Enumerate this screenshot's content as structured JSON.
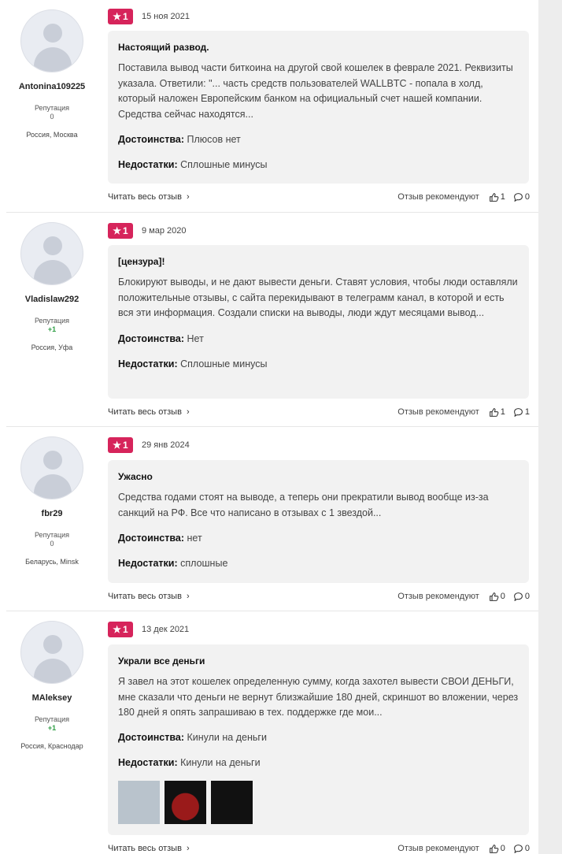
{
  "reviews": [
    {
      "username": "Antonina109225",
      "reputation_label": "Репутация",
      "reputation_value": "0",
      "location": "Россия, Москва",
      "rating": "1",
      "date": "15 ноя 2021",
      "title": "Настоящий развод.",
      "text": "Поставила вывод части биткоина на другой свой кошелек в феврале 2021. Реквизиты указала. Ответили: \"... часть средств пользователей WALLBTC - попала в холд, который наложен Европейским банком на официальный счет нашей компании. Средства сейчас находятся...",
      "pros_label": "Достоинства:",
      "pros": "Плюсов нет",
      "cons_label": "Недостатки:",
      "cons": "Сплошные минусы",
      "read_more": "Читать весь отзыв",
      "recommend": "Отзыв рекомендуют",
      "likes": "1",
      "comments": "0"
    },
    {
      "username": "Vladislaw292",
      "reputation_label": "Репутация",
      "reputation_value": "+1",
      "location": "Россия, Уфа",
      "rating": "1",
      "date": "9 мар 2020",
      "title": "[цензура]!",
      "text": "Блокируют выводы, и не дают вывести деньги. Ставят условия, чтобы люди оставляли положительные отзывы, с сайта перекидывают в телеграмм канал, в которой и есть вся эти информация. Создали списки на выводы, люди ждут месяцами вывод...",
      "pros_label": "Достоинства:",
      "pros": "Нет",
      "cons_label": "Недостатки:",
      "cons": "Сплошные минусы",
      "read_more": "Читать весь отзыв",
      "recommend": "Отзыв рекомендуют",
      "likes": "1",
      "comments": "1"
    },
    {
      "username": "fbr29",
      "reputation_label": "Репутация",
      "reputation_value": "0",
      "location": "Беларусь, Minsk",
      "rating": "1",
      "date": "29 янв 2024",
      "title": "Ужасно",
      "text": "Средства годами стоят на выводе, а теперь они прекратили вывод вообще из-за санкций на РФ. Все что написано в отзывах с 1 звездой...",
      "pros_label": "Достоинства:",
      "pros": "нет",
      "cons_label": "Недостатки:",
      "cons": "сплошные",
      "read_more": "Читать весь отзыв",
      "recommend": "Отзыв рекомендуют",
      "likes": "0",
      "comments": "0"
    },
    {
      "username": "MAleksey",
      "reputation_label": "Репутация",
      "reputation_value": "+1",
      "location": "Россия, Краснодар",
      "rating": "1",
      "date": "13 дек 2021",
      "title": "Украли все деньги",
      "text": "Я завел на этот кошелек определенную сумму, когда захотел вывести СВОИ ДЕНЬГИ, мне сказали что деньги не вернут близжайшие 180 дней, скриншот во вложении, через 180 дней я опять запрашиваю в тех. поддержке где мои...",
      "pros_label": "Достоинства:",
      "pros": "Кинули на деньги",
      "cons_label": "Недостатки:",
      "cons": "Кинули на деньги",
      "read_more": "Читать весь отзыв",
      "recommend": "Отзыв рекомендуют",
      "likes": "0",
      "comments": "0"
    }
  ],
  "colors": {
    "rating_badge": "#d6245b",
    "positive_rep": "#2e9e44",
    "card_bg": "#f2f2f2"
  }
}
